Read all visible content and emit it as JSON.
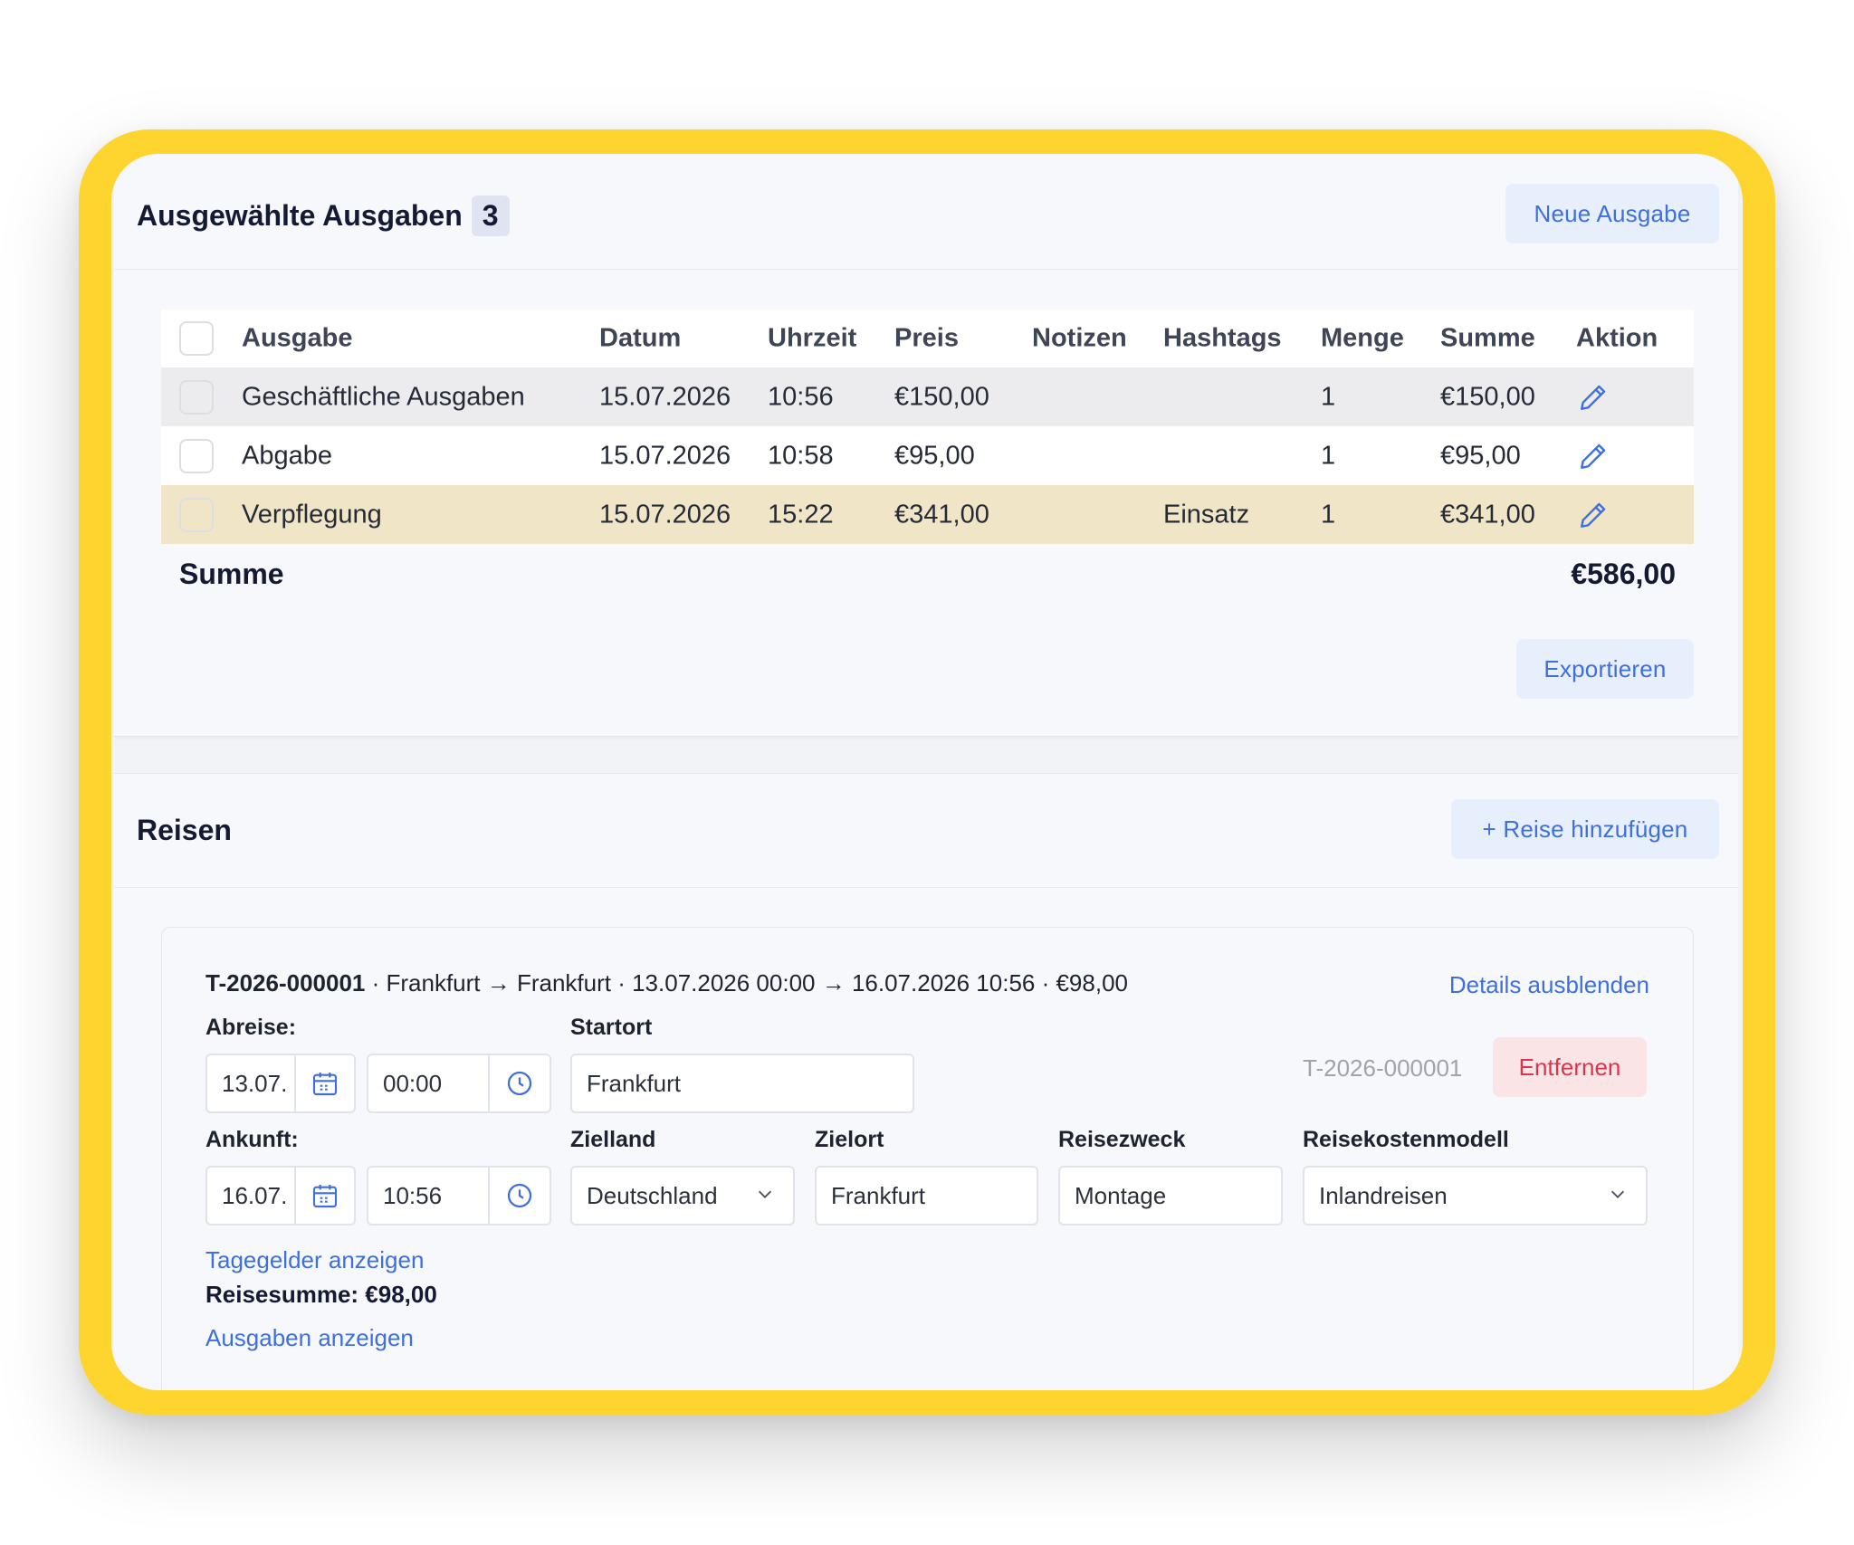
{
  "expenses_card": {
    "title": "Ausgewählte Ausgaben",
    "count": "3",
    "new_button": "Neue Ausgabe",
    "columns": [
      "Ausgabe",
      "Datum",
      "Uhrzeit",
      "Preis",
      "Notizen",
      "Hashtags",
      "Menge",
      "Summe",
      "Aktion"
    ],
    "rows": [
      {
        "ausgabe": "Geschäftliche Ausgaben",
        "datum": "15.07.2026",
        "uhrzeit": "10:56",
        "preis": "€150,00",
        "notizen": "",
        "hashtags": "",
        "menge": "1",
        "summe": "€150,00"
      },
      {
        "ausgabe": "Abgabe",
        "datum": "15.07.2026",
        "uhrzeit": "10:58",
        "preis": "€95,00",
        "notizen": "",
        "hashtags": "",
        "menge": "1",
        "summe": "€95,00"
      },
      {
        "ausgabe": "Verpflegung",
        "datum": "15.07.2026",
        "uhrzeit": "15:22",
        "preis": "€341,00",
        "notizen": "",
        "hashtags": "Einsatz",
        "menge": "1",
        "summe": "€341,00"
      }
    ],
    "total_label": "Summe",
    "total_value": "€586,00",
    "export_button": "Exportieren"
  },
  "trips_card": {
    "title": "Reisen",
    "add_button": "+ Reise hinzufügen",
    "trip": {
      "id": "T-2026-000001",
      "summary_rest": " · Frankfurt → Frankfurt · 13.07.2026 00:00 → 16.07.2026 10:56 · €98,00",
      "hide_details": "Details ausblenden",
      "departure_label": "Abreise:",
      "departure_date": "13.07.",
      "departure_time": "00:00",
      "start_label": "Startort",
      "start_value": "Frankfurt",
      "id_muted": "T-2026-000001",
      "remove_button": "Entfernen",
      "arrival_label": "Ankunft:",
      "arrival_date": "16.07.",
      "arrival_time": "10:56",
      "country_label": "Zielland",
      "country_value": "Deutschland",
      "dest_label": "Zielort",
      "dest_value": "Frankfurt",
      "purpose_label": "Reisezweck",
      "purpose_value": "Montage",
      "model_label": "Reisekostenmodell",
      "model_value": "Inlandreisen",
      "per_diem_link": "Tagegelder anzeigen",
      "trip_sum": "Reisesumme: €98,00",
      "expenses_link": "Ausgaben anzeigen"
    }
  },
  "colors": {
    "frame": "#fdd52e",
    "accent": "#3e6fde",
    "highlight_row": "#f0e6c7",
    "danger": "#d9364d"
  },
  "icons": [
    "pencil-icon",
    "calendar-icon",
    "clock-icon",
    "chevron-down-icon"
  ]
}
